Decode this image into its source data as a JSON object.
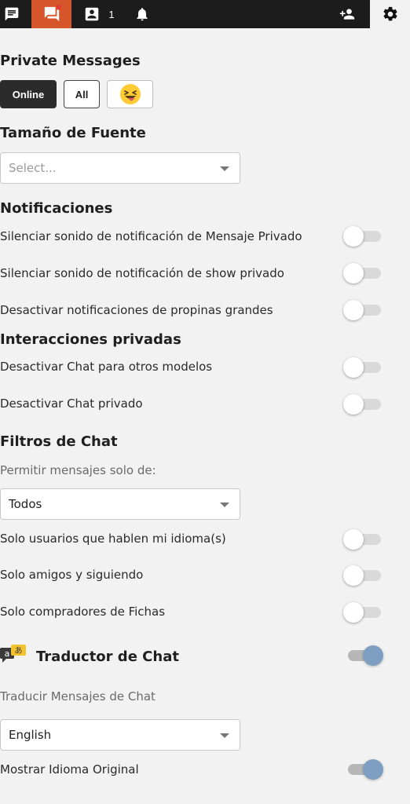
{
  "topbar": {
    "contacts_count": "1"
  },
  "private_messages": {
    "title": "Private Messages",
    "online_label": "Online",
    "all_label": "All",
    "emoji_icon": "grinning-squinting-tongue-emoji"
  },
  "font_size": {
    "title": "Tamaño de Fuente",
    "select_placeholder": "Select..."
  },
  "notifications": {
    "title": "Notificaciones",
    "items": [
      {
        "label": "Silenciar sonido de notificación de Mensaje Privado",
        "on": false
      },
      {
        "label": "Silenciar sonido de notificación de show privado",
        "on": false
      },
      {
        "label": "Desactivar notificaciones de propinas grandes",
        "on": false
      }
    ]
  },
  "private_interactions": {
    "title": "Interacciones privadas",
    "items": [
      {
        "label": "Desactivar Chat para otros modelos",
        "on": false
      },
      {
        "label": "Desactivar Chat privado",
        "on": false
      }
    ]
  },
  "chat_filters": {
    "title": "Filtros de Chat",
    "allow_label": "Permitir mensajes solo de:",
    "allow_value": "Todos",
    "items": [
      {
        "label": "Solo usuarios que hablen mi idioma(s)",
        "on": false
      },
      {
        "label": "Solo amigos y siguiendo",
        "on": false
      },
      {
        "label": "Solo compradores de Fichas",
        "on": false
      }
    ]
  },
  "translator": {
    "title": "Traductor de Chat",
    "enabled": true,
    "translate_label": "Traducir Mensajes de Chat",
    "language_value": "English",
    "show_original_label": "Mostrar Idioma Original",
    "show_original_on": true
  },
  "colors": {
    "topbar_bg": "#1c1c1c",
    "active_tab": "#d6552a",
    "page_bg": "#f2f2f2",
    "toggle_on_knob": "#7f9fc2"
  }
}
